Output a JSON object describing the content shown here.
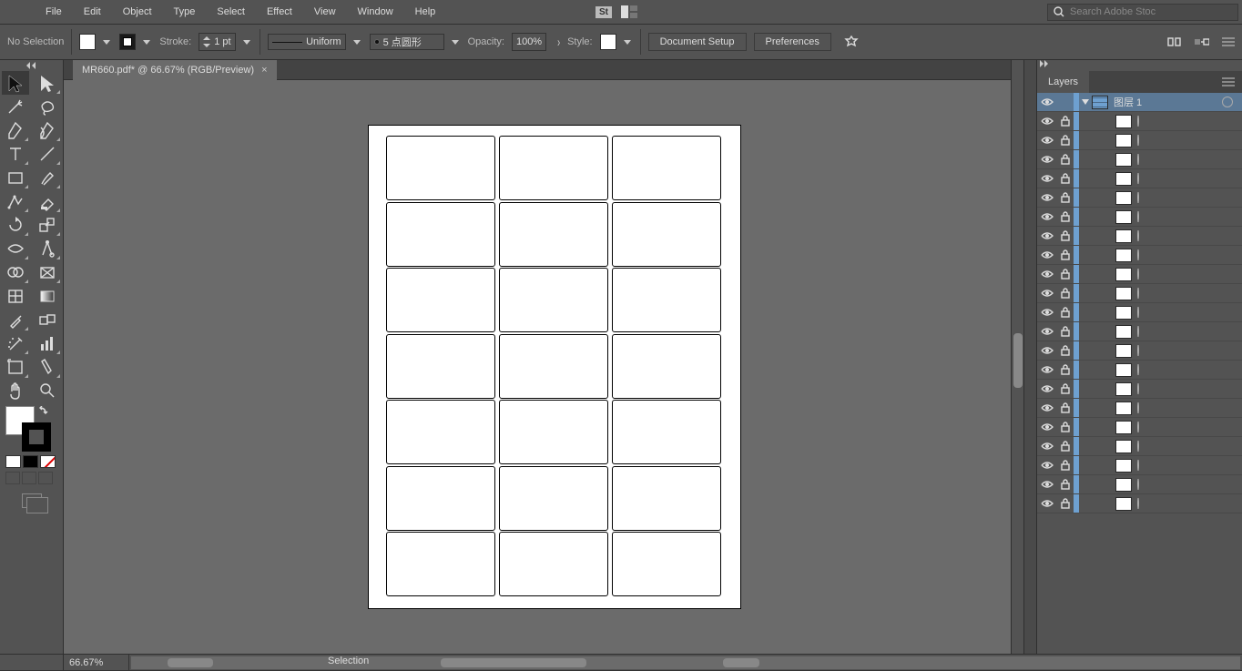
{
  "menubar": {
    "items": [
      "File",
      "Edit",
      "Object",
      "Type",
      "Select",
      "Effect",
      "View",
      "Window",
      "Help"
    ],
    "st_badge": "St",
    "search_placeholder": "Search Adobe Stoc"
  },
  "controlbar": {
    "selection_label": "No Selection",
    "stroke_label": "Stroke:",
    "stroke_weight": "1 pt",
    "stroke_type": "Uniform",
    "brush_profile": "5 点圆形",
    "opacity_label": "Opacity:",
    "opacity_value": "100%",
    "style_label": "Style:",
    "buttons": {
      "doc_setup": "Document Setup",
      "preferences": "Preferences"
    }
  },
  "doc_tab": {
    "title": "MR660.pdf* @ 66.67% (RGB/Preview)",
    "close": "×"
  },
  "layers": {
    "panel_title": "Layers",
    "top_name": "图层 1",
    "sublayer_name": "<R...",
    "sublayer_count": 21
  },
  "statusbar": {
    "zoom": "66.67%",
    "tool": "Selection"
  },
  "tools": {
    "left": [
      "selection",
      "direct-selection",
      "magic-wand",
      "lasso",
      "pen",
      "curvature",
      "type",
      "line",
      "rectangle",
      "paintbrush",
      "shaper",
      "eraser",
      "rotate",
      "scale",
      "width",
      "free-transform",
      "shape-builder",
      "perspective",
      "mesh",
      "gradient",
      "eyedropper",
      "blend",
      "symbol-sprayer",
      "column-graph",
      "artboard",
      "slice",
      "hand",
      "zoom"
    ]
  }
}
